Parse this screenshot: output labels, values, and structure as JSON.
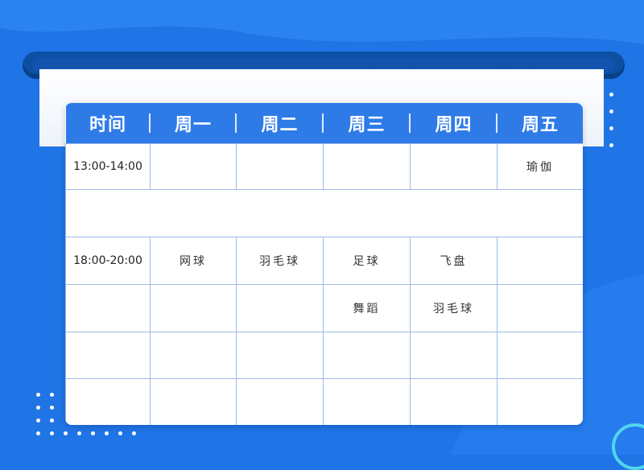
{
  "schedule": {
    "headers": [
      "时间",
      "周一",
      "周二",
      "周三",
      "周四",
      "周五"
    ],
    "rows": [
      {
        "time": "13:00-14:00",
        "cells": [
          "",
          "",
          "",
          "",
          "瑜伽"
        ]
      },
      {
        "time": "",
        "cells": []
      },
      {
        "time": "18:00-20:00",
        "cells": [
          "网球",
          "羽毛球",
          "足球",
          "飞盘",
          ""
        ]
      },
      {
        "time": "",
        "cells": [
          "",
          "",
          "舞蹈",
          "羽毛球",
          ""
        ]
      },
      {
        "time": "",
        "cells": [
          "",
          "",
          "",
          "",
          ""
        ]
      },
      {
        "time": "",
        "cells": [
          "",
          "",
          "",
          "",
          ""
        ]
      }
    ]
  },
  "colors": {
    "background": "#1f74e6",
    "header": "#2e7be8",
    "roller": "#0d4fa3",
    "ring_accent": "#4fd6ee",
    "grid_line": "#9dbbe6"
  }
}
